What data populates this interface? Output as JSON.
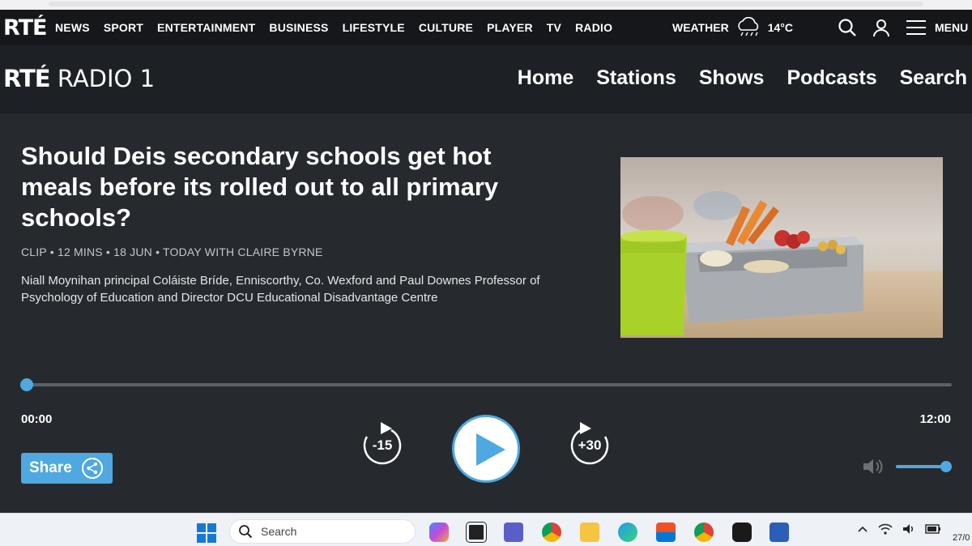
{
  "global_nav": {
    "logo": "RTÉ",
    "items": [
      "NEWS",
      "SPORT",
      "ENTERTAINMENT",
      "BUSINESS",
      "LIFESTYLE",
      "CULTURE",
      "PLAYER",
      "TV",
      "RADIO"
    ],
    "weather_label": "WEATHER",
    "temperature": "14°C",
    "menu_label": "MENU"
  },
  "radio_header": {
    "logo_brand": "RTÉ",
    "logo_station": "RADIO 1",
    "nav": [
      "Home",
      "Stations",
      "Shows",
      "Podcasts",
      "Search"
    ]
  },
  "clip": {
    "title": "Should Deis secondary schools get hot meals before its rolled out to all primary schools?",
    "meta": "CLIP • 12 MINS • 18 JUN • TODAY WITH CLAIRE BYRNE",
    "description": "Niall Moynihan principal Coláiste Bríde, Enniscorthy, Co. Wexford and Paul Downes Professor of Psychology of Education and Director DCU Educational Disadvantage Centre"
  },
  "player": {
    "time_elapsed": "00:00",
    "time_total": "12:00",
    "progress": 0,
    "skip_back_label": "-15",
    "skip_forward_label": "+30",
    "share_label": "Share",
    "volume": 1.0,
    "accent_color": "#4fa8e0"
  },
  "taskbar": {
    "search_label": "Search",
    "date_partial": "27/0"
  }
}
